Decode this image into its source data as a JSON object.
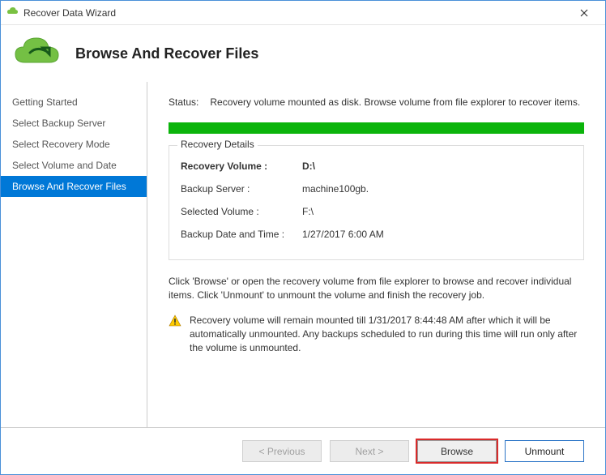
{
  "window": {
    "title": "Recover Data Wizard"
  },
  "header": {
    "title": "Browse And Recover Files"
  },
  "sidebar": {
    "items": [
      {
        "label": "Getting Started"
      },
      {
        "label": "Select Backup Server"
      },
      {
        "label": "Select Recovery Mode"
      },
      {
        "label": "Select Volume and Date"
      },
      {
        "label": "Browse And Recover Files"
      }
    ]
  },
  "status": {
    "label": "Status:",
    "text": "Recovery volume mounted as disk. Browse volume from file explorer to recover items."
  },
  "details": {
    "legend": "Recovery Details",
    "rows": [
      {
        "key": "Recovery Volume :",
        "value": "D:\\"
      },
      {
        "key": "Backup Server :",
        "value": "machine100gb."
      },
      {
        "key": "Selected Volume :",
        "value": "F:\\"
      },
      {
        "key": "Backup Date and Time :",
        "value": "1/27/2017 6:00 AM"
      }
    ]
  },
  "instruction": "Click 'Browse' or open the recovery volume from file explorer to browse and recover individual items. Click 'Unmount' to unmount the volume and finish the recovery job.",
  "warning": "Recovery volume will remain mounted till 1/31/2017 8:44:48 AM after which it will be automatically unmounted. Any backups scheduled to run during this time will run only after the volume is unmounted.",
  "buttons": {
    "previous": "< Previous",
    "next": "Next >",
    "browse": "Browse",
    "unmount": "Unmount"
  }
}
